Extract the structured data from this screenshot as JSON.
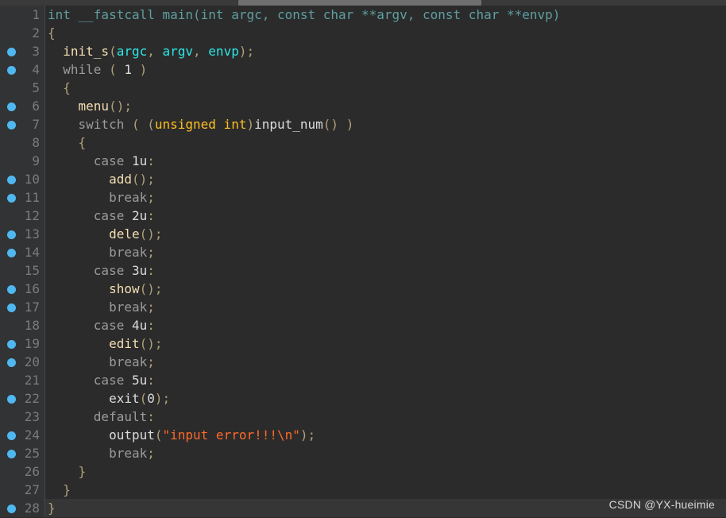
{
  "editor": {
    "theme_background": "#2b2b2b",
    "gutter_background": "#313335",
    "current_line_background": "#363636",
    "breakpoint_color": "#4fb8f0",
    "current_line": 28,
    "scrollbar": {
      "orientation": "horizontal",
      "thumb_color": "#6f6f6f",
      "track_color": "#3a3a3a"
    },
    "colors": {
      "signature": "#5f9ea0",
      "keyword": "#9b9b9b",
      "function": "#f5deb3",
      "variable": "#2ee6e6",
      "punctuation": "#b0a07a",
      "plain": "#dcdcdc",
      "type_cast": "#ffc020",
      "string": "#ff6a29",
      "line_number": "#7b7b7b"
    },
    "lines": [
      {
        "number": 1,
        "breakpoint": false,
        "tokens": [
          {
            "text": "int __fastcall main(int argc, const char **argv, const char **envp)",
            "cls": "t-sig"
          }
        ]
      },
      {
        "number": 2,
        "breakpoint": false,
        "tokens": [
          {
            "text": "{",
            "cls": "t-punc"
          }
        ]
      },
      {
        "number": 3,
        "breakpoint": true,
        "tokens": [
          {
            "text": "  ",
            "cls": "t-plain"
          },
          {
            "text": "init_s",
            "cls": "t-fn"
          },
          {
            "text": "(",
            "cls": "t-punc"
          },
          {
            "text": "argc",
            "cls": "t-var"
          },
          {
            "text": ", ",
            "cls": "t-punc"
          },
          {
            "text": "argv",
            "cls": "t-var"
          },
          {
            "text": ", ",
            "cls": "t-punc"
          },
          {
            "text": "envp",
            "cls": "t-var"
          },
          {
            "text": ");",
            "cls": "t-punc"
          }
        ]
      },
      {
        "number": 4,
        "breakpoint": true,
        "tokens": [
          {
            "text": "  ",
            "cls": "t-plain"
          },
          {
            "text": "while",
            "cls": "t-kw"
          },
          {
            "text": " ( ",
            "cls": "t-punc"
          },
          {
            "text": "1",
            "cls": "t-num"
          },
          {
            "text": " )",
            "cls": "t-punc"
          }
        ]
      },
      {
        "number": 5,
        "breakpoint": false,
        "tokens": [
          {
            "text": "  {",
            "cls": "t-punc"
          }
        ]
      },
      {
        "number": 6,
        "breakpoint": true,
        "tokens": [
          {
            "text": "    ",
            "cls": "t-plain"
          },
          {
            "text": "menu",
            "cls": "t-fn"
          },
          {
            "text": "();",
            "cls": "t-punc"
          }
        ]
      },
      {
        "number": 7,
        "breakpoint": true,
        "tokens": [
          {
            "text": "    ",
            "cls": "t-plain"
          },
          {
            "text": "switch",
            "cls": "t-kw"
          },
          {
            "text": " ( (",
            "cls": "t-punc"
          },
          {
            "text": "unsigned int",
            "cls": "t-type"
          },
          {
            "text": ")",
            "cls": "t-punc"
          },
          {
            "text": "input_num",
            "cls": "t-plain"
          },
          {
            "text": "() )",
            "cls": "t-punc"
          }
        ]
      },
      {
        "number": 8,
        "breakpoint": false,
        "tokens": [
          {
            "text": "    {",
            "cls": "t-punc"
          }
        ]
      },
      {
        "number": 9,
        "breakpoint": false,
        "tokens": [
          {
            "text": "      ",
            "cls": "t-plain"
          },
          {
            "text": "case",
            "cls": "t-kw"
          },
          {
            "text": " ",
            "cls": "t-plain"
          },
          {
            "text": "1u",
            "cls": "t-plain"
          },
          {
            "text": ":",
            "cls": "t-punc"
          }
        ]
      },
      {
        "number": 10,
        "breakpoint": true,
        "tokens": [
          {
            "text": "        ",
            "cls": "t-plain"
          },
          {
            "text": "add",
            "cls": "t-fn"
          },
          {
            "text": "();",
            "cls": "t-punc"
          }
        ]
      },
      {
        "number": 11,
        "breakpoint": true,
        "tokens": [
          {
            "text": "        ",
            "cls": "t-plain"
          },
          {
            "text": "break",
            "cls": "t-kw"
          },
          {
            "text": ";",
            "cls": "t-punc"
          }
        ]
      },
      {
        "number": 12,
        "breakpoint": false,
        "tokens": [
          {
            "text": "      ",
            "cls": "t-plain"
          },
          {
            "text": "case",
            "cls": "t-kw"
          },
          {
            "text": " ",
            "cls": "t-plain"
          },
          {
            "text": "2u",
            "cls": "t-plain"
          },
          {
            "text": ":",
            "cls": "t-punc"
          }
        ]
      },
      {
        "number": 13,
        "breakpoint": true,
        "tokens": [
          {
            "text": "        ",
            "cls": "t-plain"
          },
          {
            "text": "dele",
            "cls": "t-fn"
          },
          {
            "text": "();",
            "cls": "t-punc"
          }
        ]
      },
      {
        "number": 14,
        "breakpoint": true,
        "tokens": [
          {
            "text": "        ",
            "cls": "t-plain"
          },
          {
            "text": "break",
            "cls": "t-kw"
          },
          {
            "text": ";",
            "cls": "t-punc"
          }
        ]
      },
      {
        "number": 15,
        "breakpoint": false,
        "tokens": [
          {
            "text": "      ",
            "cls": "t-plain"
          },
          {
            "text": "case",
            "cls": "t-kw"
          },
          {
            "text": " ",
            "cls": "t-plain"
          },
          {
            "text": "3u",
            "cls": "t-plain"
          },
          {
            "text": ":",
            "cls": "t-punc"
          }
        ]
      },
      {
        "number": 16,
        "breakpoint": true,
        "tokens": [
          {
            "text": "        ",
            "cls": "t-plain"
          },
          {
            "text": "show",
            "cls": "t-fn"
          },
          {
            "text": "();",
            "cls": "t-punc"
          }
        ]
      },
      {
        "number": 17,
        "breakpoint": true,
        "tokens": [
          {
            "text": "        ",
            "cls": "t-plain"
          },
          {
            "text": "break",
            "cls": "t-kw"
          },
          {
            "text": ";",
            "cls": "t-punc"
          }
        ]
      },
      {
        "number": 18,
        "breakpoint": false,
        "tokens": [
          {
            "text": "      ",
            "cls": "t-plain"
          },
          {
            "text": "case",
            "cls": "t-kw"
          },
          {
            "text": " ",
            "cls": "t-plain"
          },
          {
            "text": "4u",
            "cls": "t-plain"
          },
          {
            "text": ":",
            "cls": "t-punc"
          }
        ]
      },
      {
        "number": 19,
        "breakpoint": true,
        "tokens": [
          {
            "text": "        ",
            "cls": "t-plain"
          },
          {
            "text": "edit",
            "cls": "t-fn"
          },
          {
            "text": "();",
            "cls": "t-punc"
          }
        ]
      },
      {
        "number": 20,
        "breakpoint": true,
        "tokens": [
          {
            "text": "        ",
            "cls": "t-plain"
          },
          {
            "text": "break",
            "cls": "t-kw"
          },
          {
            "text": ";",
            "cls": "t-punc"
          }
        ]
      },
      {
        "number": 21,
        "breakpoint": false,
        "tokens": [
          {
            "text": "      ",
            "cls": "t-plain"
          },
          {
            "text": "case",
            "cls": "t-kw"
          },
          {
            "text": " ",
            "cls": "t-plain"
          },
          {
            "text": "5u",
            "cls": "t-plain"
          },
          {
            "text": ":",
            "cls": "t-punc"
          }
        ]
      },
      {
        "number": 22,
        "breakpoint": true,
        "tokens": [
          {
            "text": "        ",
            "cls": "t-plain"
          },
          {
            "text": "exit",
            "cls": "t-plain"
          },
          {
            "text": "(",
            "cls": "t-punc"
          },
          {
            "text": "0",
            "cls": "t-num"
          },
          {
            "text": ");",
            "cls": "t-punc"
          }
        ]
      },
      {
        "number": 23,
        "breakpoint": false,
        "tokens": [
          {
            "text": "      ",
            "cls": "t-plain"
          },
          {
            "text": "default",
            "cls": "t-kw"
          },
          {
            "text": ":",
            "cls": "t-punc"
          }
        ]
      },
      {
        "number": 24,
        "breakpoint": true,
        "tokens": [
          {
            "text": "        ",
            "cls": "t-plain"
          },
          {
            "text": "output",
            "cls": "t-plain"
          },
          {
            "text": "(",
            "cls": "t-punc"
          },
          {
            "text": "\"input error!!!\\n\"",
            "cls": "t-str"
          },
          {
            "text": ");",
            "cls": "t-punc"
          }
        ]
      },
      {
        "number": 25,
        "breakpoint": true,
        "tokens": [
          {
            "text": "        ",
            "cls": "t-plain"
          },
          {
            "text": "break",
            "cls": "t-kw"
          },
          {
            "text": ";",
            "cls": "t-punc"
          }
        ]
      },
      {
        "number": 26,
        "breakpoint": false,
        "tokens": [
          {
            "text": "    }",
            "cls": "t-punc"
          }
        ]
      },
      {
        "number": 27,
        "breakpoint": false,
        "tokens": [
          {
            "text": "  }",
            "cls": "t-punc"
          }
        ]
      },
      {
        "number": 28,
        "breakpoint": true,
        "tokens": [
          {
            "text": "}",
            "cls": "t-punc"
          }
        ]
      }
    ]
  },
  "watermark": {
    "text": "CSDN @YX-hueimie"
  }
}
